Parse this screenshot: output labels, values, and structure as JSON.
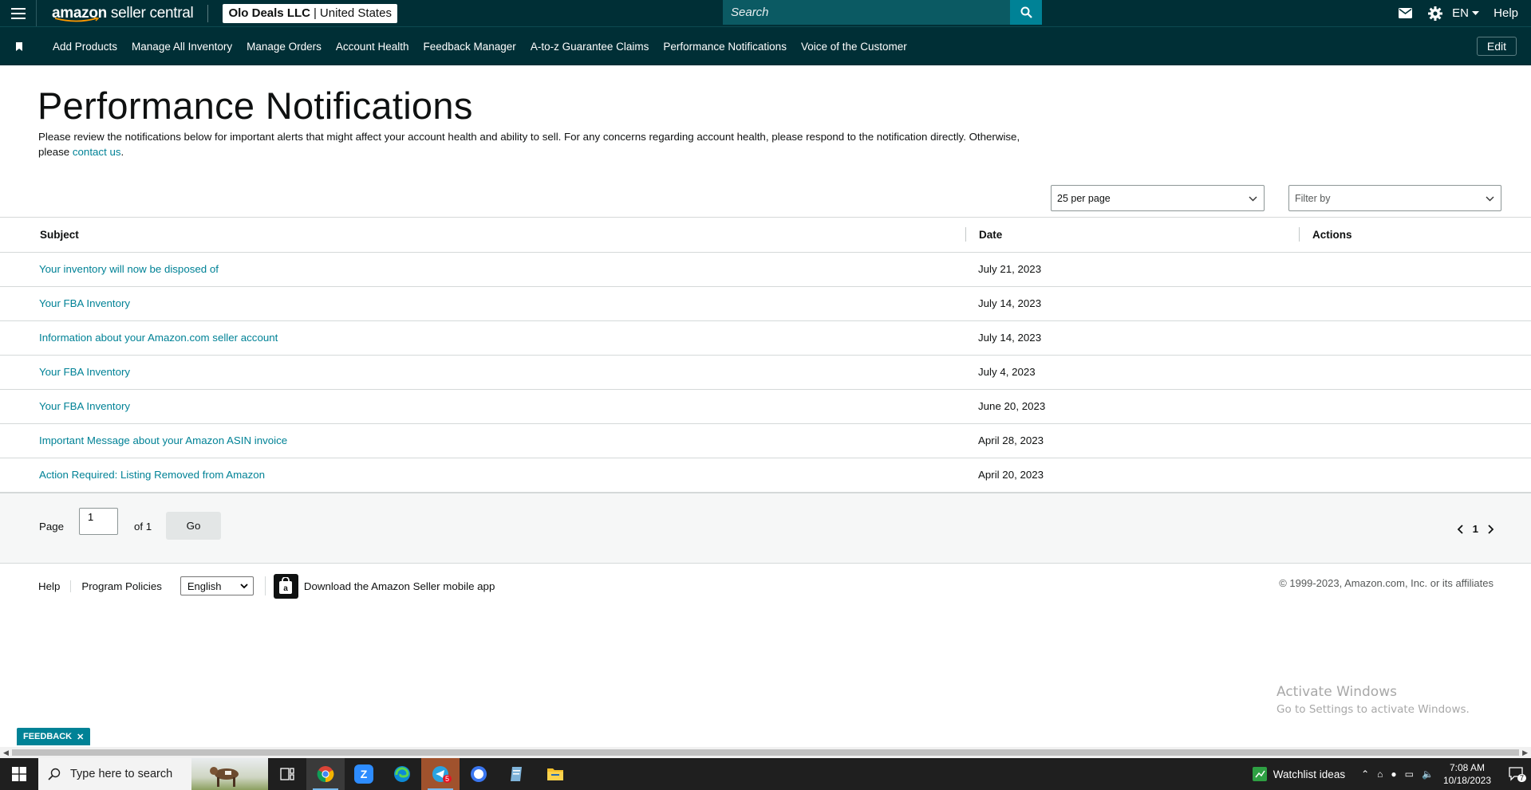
{
  "topbar": {
    "logo_text_amazon": "amazon",
    "logo_text_rest": " seller central",
    "account_name": "Olo Deals LLC",
    "account_region": "United States",
    "search_placeholder": "Search",
    "language": "EN",
    "help": "Help"
  },
  "nav": {
    "items": [
      "Add Products",
      "Manage All Inventory",
      "Manage Orders",
      "Account Health",
      "Feedback Manager",
      "A-to-z Guarantee Claims",
      "Performance Notifications",
      "Voice of the Customer"
    ],
    "edit": "Edit"
  },
  "page": {
    "title": "Performance Notifications",
    "intro_text": "Please review the notifications below for important alerts that might affect your account health and ability to sell. For any concerns regarding account health, please respond to the notification directly. Otherwise, please ",
    "intro_link": "contact us",
    "intro_end": ".",
    "per_page": "25 per page",
    "filter_placeholder": "Filter by"
  },
  "table": {
    "headers": {
      "subject": "Subject",
      "date": "Date",
      "actions": "Actions"
    },
    "rows": [
      {
        "subject": "Your inventory will now be disposed of",
        "date": "July 21, 2023"
      },
      {
        "subject": "Your FBA Inventory",
        "date": "July 14, 2023"
      },
      {
        "subject": "Information about your Amazon.com seller account",
        "date": "July 14, 2023"
      },
      {
        "subject": "Your FBA Inventory",
        "date": "July 4, 2023"
      },
      {
        "subject": "Your FBA Inventory",
        "date": "June 20, 2023"
      },
      {
        "subject": "Important Message about your Amazon ASIN invoice",
        "date": "April 28, 2023"
      },
      {
        "subject": "Action Required: Listing Removed from Amazon",
        "date": "April 20, 2023"
      }
    ]
  },
  "pager": {
    "page_label": "Page",
    "page_value": "1",
    "of_label": "of 1",
    "go": "Go",
    "current": "1"
  },
  "footer": {
    "help": "Help",
    "policies": "Program Policies",
    "language": "English",
    "app": "Download the Amazon Seller mobile app",
    "copyright": "© 1999-2023, Amazon.com, Inc. or its affiliates"
  },
  "watermark": {
    "line1": "Activate Windows",
    "line2": "Go to Settings to activate Windows."
  },
  "feedback": "FEEDBACK",
  "taskbar": {
    "search_placeholder": "Type here to search",
    "widget": "Watchlist ideas",
    "time": "7:08 AM",
    "date": "10/18/2023",
    "notif_count": "7",
    "badge_count": "5"
  },
  "colors": {
    "header_bg": "#002f36",
    "link": "#008296",
    "accent": "#008296"
  }
}
